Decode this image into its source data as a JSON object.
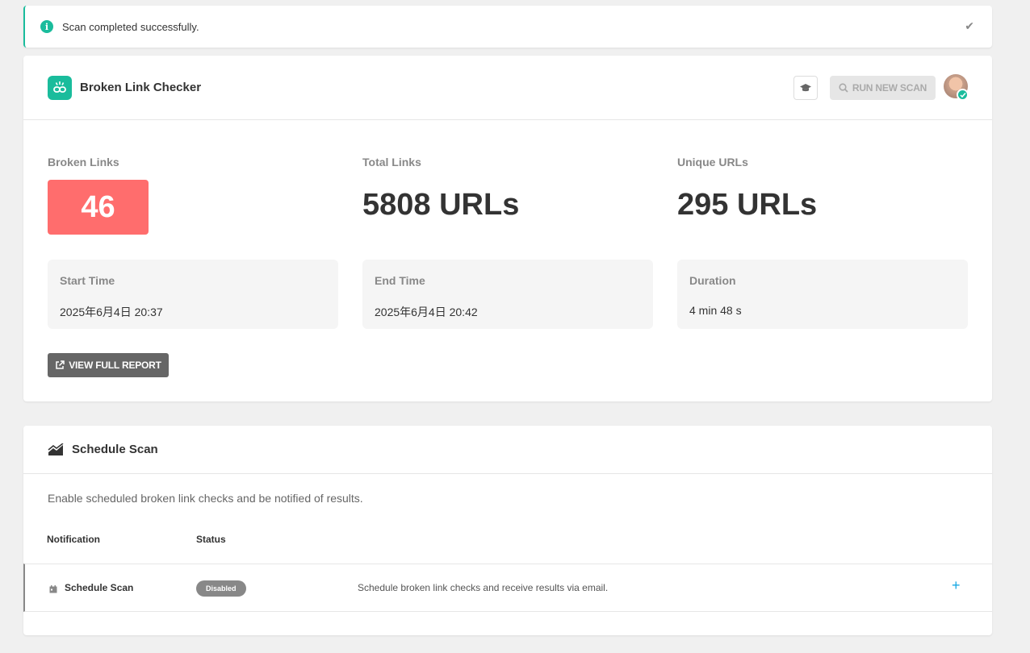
{
  "notice": {
    "message": "Scan completed successfully.",
    "icon": "info-icon",
    "dismiss_icon": "check-icon"
  },
  "header": {
    "title": "Broken Link Checker",
    "run_button": "RUN NEW SCAN",
    "icons": [
      "broken-link-app-icon",
      "graduation-cap-icon",
      "search-icon",
      "avatar",
      "check-icon"
    ]
  },
  "stats": {
    "broken": {
      "label": "Broken Links",
      "value": "46"
    },
    "total": {
      "label": "Total Links",
      "value": "5808 URLs"
    },
    "unique": {
      "label": "Unique URLs",
      "value": "295 URLs"
    }
  },
  "times": {
    "start": {
      "label": "Start Time",
      "value": "2025年6月4日 20:37"
    },
    "end": {
      "label": "End Time",
      "value": "2025年6月4日 20:42"
    },
    "duration": {
      "label": "Duration",
      "value": "4 min 48 s"
    }
  },
  "report_button": "VIEW FULL REPORT",
  "schedule": {
    "title": "Schedule Scan",
    "description": "Enable scheduled broken link checks and be notified of results.",
    "columns": {
      "notification": "Notification",
      "status": "Status"
    },
    "row": {
      "name": "Schedule Scan",
      "status": "Disabled",
      "description": "Schedule broken link checks and receive results via email.",
      "action": "+"
    }
  },
  "colors": {
    "accent": "#1abc9c",
    "broken": "#ff6d6d",
    "link": "#17a8e3",
    "button_dark": "#666666"
  }
}
